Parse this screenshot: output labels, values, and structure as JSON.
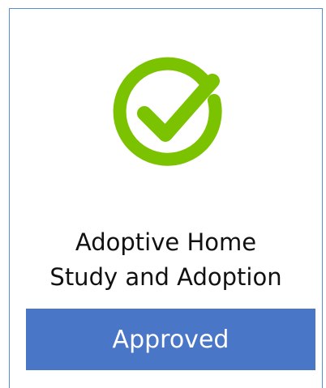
{
  "card": {
    "title_line1": "Adoptive Home",
    "title_line2": "Study and Adoption",
    "status_label": "Approved"
  },
  "icons": {
    "status": "check-circle-icon"
  },
  "colors": {
    "check_green": "#7bc300",
    "status_bar_blue": "#4a76c8",
    "card_border": "#5b8bd0"
  }
}
